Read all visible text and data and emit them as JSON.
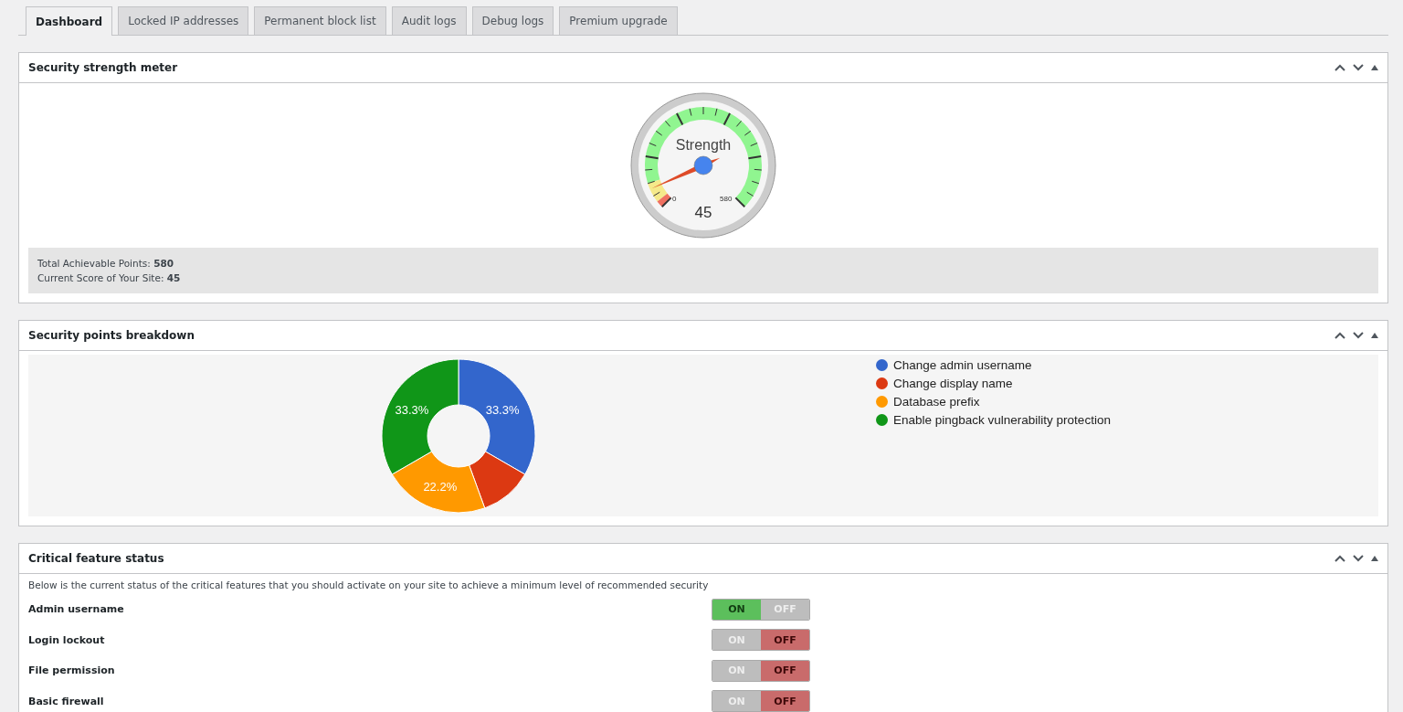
{
  "tabs": [
    {
      "label": "Dashboard",
      "selected": true
    },
    {
      "label": "Locked IP addresses",
      "selected": false
    },
    {
      "label": "Permanent block list",
      "selected": false
    },
    {
      "label": "Audit logs",
      "selected": false
    },
    {
      "label": "Debug logs",
      "selected": false
    },
    {
      "label": "Premium upgrade",
      "selected": false
    }
  ],
  "strength_panel": {
    "title": "Security strength meter",
    "gauge": {
      "label": "Strength",
      "min": "0",
      "max": "580",
      "reading": "45"
    },
    "summary": [
      {
        "label": "Total Achievable Points:",
        "value": "580"
      },
      {
        "label": "Current Score of Your Site:",
        "value": "45"
      }
    ]
  },
  "breakdown_panel": {
    "title": "Security points breakdown",
    "chart_data": {
      "type": "donut",
      "categories": [
        "Change admin username",
        "Change display name",
        "Database prefix",
        "Enable pingback vulnerability protection"
      ],
      "values": [
        33.3,
        11.1,
        22.2,
        33.3
      ],
      "colors": [
        "#3366cc",
        "#dc3912",
        "#ff9900",
        "#109618"
      ],
      "value_labels": [
        "33.3%",
        null,
        "22.2%",
        "33.3%"
      ]
    }
  },
  "critical_panel": {
    "title": "Critical feature status",
    "intro": "Below is the current status of the critical features that you should activate on your site to achieve a minimum level of recommended security",
    "features": [
      {
        "name": "Admin username",
        "on": true,
        "on_label": "ON",
        "off_label": "OFF"
      },
      {
        "name": "Login lockout",
        "on": false,
        "on_label": "ON",
        "off_label": "OFF"
      },
      {
        "name": "File permission",
        "on": false,
        "on_label": "ON",
        "off_label": "OFF"
      },
      {
        "name": "Basic firewall",
        "on": false,
        "on_label": "ON",
        "off_label": "OFF"
      }
    ]
  }
}
